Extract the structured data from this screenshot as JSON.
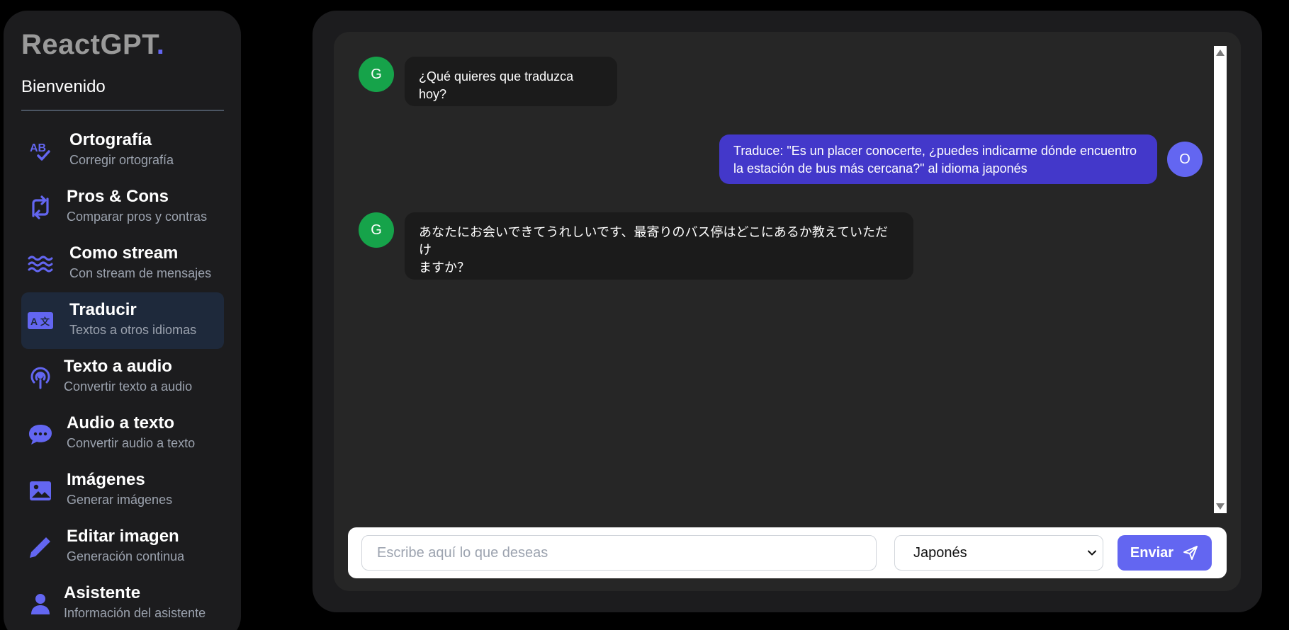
{
  "app": {
    "logo_text": "ReactGPT",
    "logo_dot": ".",
    "welcome": "Bienvenido",
    "accent_color": "#6366f1"
  },
  "sidebar": {
    "items": [
      {
        "title": "Ortografía",
        "subtitle": "Corregir ortografía",
        "icon": "spellcheck-icon",
        "active": false
      },
      {
        "title": "Pros & Cons",
        "subtitle": "Comparar pros y contras",
        "icon": "arrows-swap-icon",
        "active": false
      },
      {
        "title": "Como stream",
        "subtitle": "Con stream de mensajes",
        "icon": "waves-icon",
        "active": false
      },
      {
        "title": "Traducir",
        "subtitle": "Textos a otros idiomas",
        "icon": "translate-icon",
        "active": true
      },
      {
        "title": "Texto a audio",
        "subtitle": "Convertir texto a audio",
        "icon": "podcast-icon",
        "active": false
      },
      {
        "title": "Audio a texto",
        "subtitle": "Convertir audio a texto",
        "icon": "chat-bubble-icon",
        "active": false
      },
      {
        "title": "Imágenes",
        "subtitle": "Generar imágenes",
        "icon": "image-icon",
        "active": false
      },
      {
        "title": "Editar imagen",
        "subtitle": "Generación continua",
        "icon": "pencil-icon",
        "active": false
      },
      {
        "title": "Asistente",
        "subtitle": "Información del asistente",
        "icon": "user-icon",
        "active": false
      }
    ]
  },
  "chat": {
    "messages": [
      {
        "sender": "bot",
        "avatar": "G",
        "text": "¿Qué quieres que traduzca hoy?"
      },
      {
        "sender": "user",
        "avatar": "O",
        "line1": "Traduce: \"Es un placer conocerte, ¿puedes indicarme dónde encuentro",
        "line2": "la estación de bus más cercana?\" al idioma japonés"
      },
      {
        "sender": "bot",
        "avatar": "G",
        "line1": "あなたにお会いできてうれしいです、最寄りのバス停はどこにあるか教えていただけ",
        "line2": "ますか？"
      }
    ]
  },
  "input": {
    "placeholder": "Escribe aquí lo que deseas",
    "value": "",
    "language_selected": "Japonés",
    "send_label": "Enviar"
  }
}
